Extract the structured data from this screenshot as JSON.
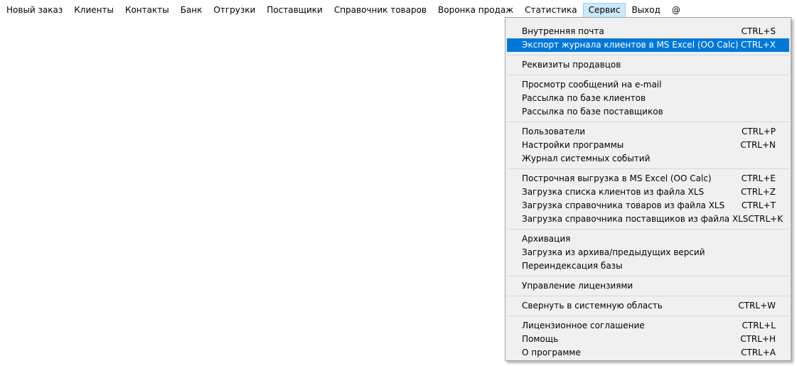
{
  "menubar": {
    "items": [
      {
        "label": "Новый заказ"
      },
      {
        "label": "Клиенты"
      },
      {
        "label": "Контакты"
      },
      {
        "label": "Банк"
      },
      {
        "label": "Отгрузки"
      },
      {
        "label": "Поставщики"
      },
      {
        "label": "Справочник товаров"
      },
      {
        "label": "Воронка продаж"
      },
      {
        "label": "Статистика"
      },
      {
        "label": "Сервис",
        "active": true
      },
      {
        "label": "Выход"
      },
      {
        "label": "@"
      }
    ]
  },
  "service_menu": {
    "groups": [
      [
        {
          "label": "Внутренняя почта",
          "shortcut": "CTRL+S"
        },
        {
          "label": "Экспорт журнала клиентов в MS Excel (OO Calc)",
          "shortcut": "CTRL+X",
          "highlighted": true
        }
      ],
      [
        {
          "label": "Реквизиты продавцов",
          "shortcut": ""
        }
      ],
      [
        {
          "label": "Просмотр сообщений на e-mail",
          "shortcut": ""
        },
        {
          "label": "Рассылка по базе клиентов",
          "shortcut": ""
        },
        {
          "label": "Рассылка по базе поставщиков",
          "shortcut": ""
        }
      ],
      [
        {
          "label": "Пользователи",
          "shortcut": "CTRL+P"
        },
        {
          "label": "Настройки программы",
          "shortcut": "CTRL+N"
        },
        {
          "label": "Журнал системных событий",
          "shortcut": ""
        }
      ],
      [
        {
          "label": "Построчная выгрузка в MS Excel (OO Calc)",
          "shortcut": "CTRL+E"
        },
        {
          "label": "Загрузка списка клиентов из файла XLS",
          "shortcut": "CTRL+Z"
        },
        {
          "label": "Загрузка справочника товаров из файла XLS",
          "shortcut": "CTRL+T"
        },
        {
          "label": "Загрузка справочника поставщиков из файла XLS",
          "shortcut": "CTRL+K"
        }
      ],
      [
        {
          "label": "Архивация",
          "shortcut": ""
        },
        {
          "label": "Загрузка из архива/предыдущих версий",
          "shortcut": ""
        },
        {
          "label": "Переиндексация базы",
          "shortcut": ""
        }
      ],
      [
        {
          "label": "Управление лицензиями",
          "shortcut": ""
        }
      ],
      [
        {
          "label": "Свернуть в системную область",
          "shortcut": "CTRL+W"
        }
      ],
      [
        {
          "label": "Лицензионное соглашение",
          "shortcut": "CTRL+L"
        },
        {
          "label": "Помощь",
          "shortcut": "CTRL+H"
        },
        {
          "label": "О программе",
          "shortcut": "CTRL+A"
        }
      ]
    ]
  },
  "colors": {
    "highlight": "#0078d7",
    "active_menu_bg": "#cce8ff",
    "menu_bg": "#f0f0f0"
  }
}
